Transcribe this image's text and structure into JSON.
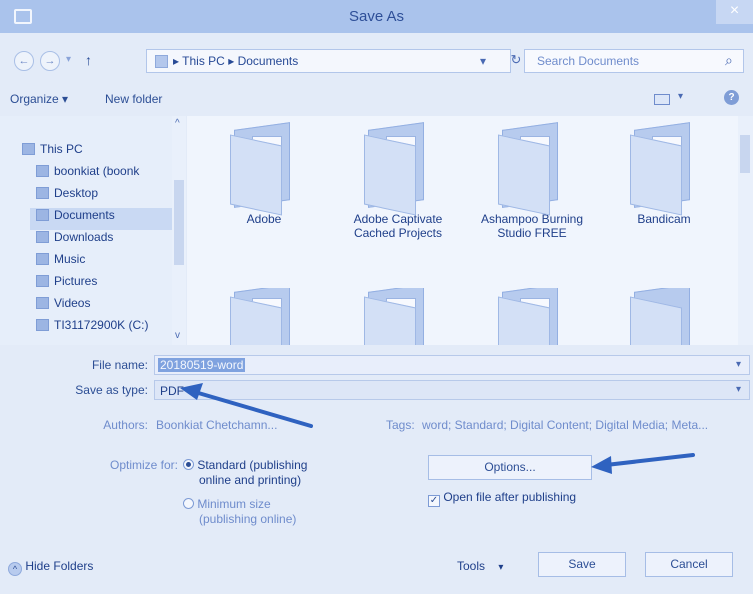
{
  "window": {
    "title": "Save As",
    "close_glyph": "×"
  },
  "nav": {
    "back_glyph": "←",
    "forward_glyph": "→",
    "recent_glyph": "▾",
    "up_glyph": "↑",
    "breadcrumb": [
      "This PC",
      "Documents"
    ],
    "crumb_sep": "▸",
    "dropdown_glyph": "▾",
    "refresh_glyph": "↻",
    "search_placeholder": "Search Documents",
    "search_glyph": "⌕"
  },
  "toolbar": {
    "organize": "Organize ▾",
    "new_folder": "New folder",
    "view_glyph": "▾",
    "help_glyph": "?"
  },
  "sidebar": {
    "items": [
      {
        "label": "This PC",
        "icon": "computer-icon"
      },
      {
        "label": "boonkiat (boonk",
        "icon": "user-icon"
      },
      {
        "label": "Desktop",
        "icon": "desktop-icon"
      },
      {
        "label": "Documents",
        "icon": "documents-icon"
      },
      {
        "label": "Downloads",
        "icon": "downloads-icon"
      },
      {
        "label": "Music",
        "icon": "music-icon"
      },
      {
        "label": "Pictures",
        "icon": "pictures-icon"
      },
      {
        "label": "Videos",
        "icon": "videos-icon"
      },
      {
        "label": "TI31172900K (C:)",
        "icon": "drive-icon"
      }
    ],
    "scroll_up": "^",
    "scroll_down": "v"
  },
  "files": [
    {
      "name": "Adobe"
    },
    {
      "name": "Adobe Captivate Cached Projects"
    },
    {
      "name": "Ashampoo Burning Studio FREE"
    },
    {
      "name": "Bandicam"
    },
    {
      "name": ""
    },
    {
      "name": ""
    },
    {
      "name": ""
    },
    {
      "name": ""
    }
  ],
  "form": {
    "file_name_label": "File name:",
    "file_name_value": "20180519-word",
    "save_type_label": "Save as type:",
    "save_type_value": "PDF",
    "authors_label": "Authors:",
    "authors_value": "Boonkiat Chetchamn...",
    "tags_label": "Tags:",
    "tags_value": "word; Standard; Digital Content; Digital Media; Meta...",
    "optimize_label": "Optimize for:",
    "opt_standard": "Standard (publishing online and printing)",
    "opt_standard_l1": "Standard (publishing",
    "opt_standard_l2": "online and printing)",
    "opt_min_l1": "Minimum size",
    "opt_min_l2": "(publishing online)",
    "options_button": "Options...",
    "open_after": "Open file after publishing",
    "check_glyph": "✓"
  },
  "footer": {
    "hide_folders": "Hide Folders",
    "hide_glyph": "^",
    "tools": "Tools",
    "tools_glyph": "▾",
    "save": "Save",
    "cancel": "Cancel"
  },
  "colors": {
    "accent": "#2c4e95",
    "arrow": "#2f62c0",
    "titlebar": "#aac3ec"
  }
}
